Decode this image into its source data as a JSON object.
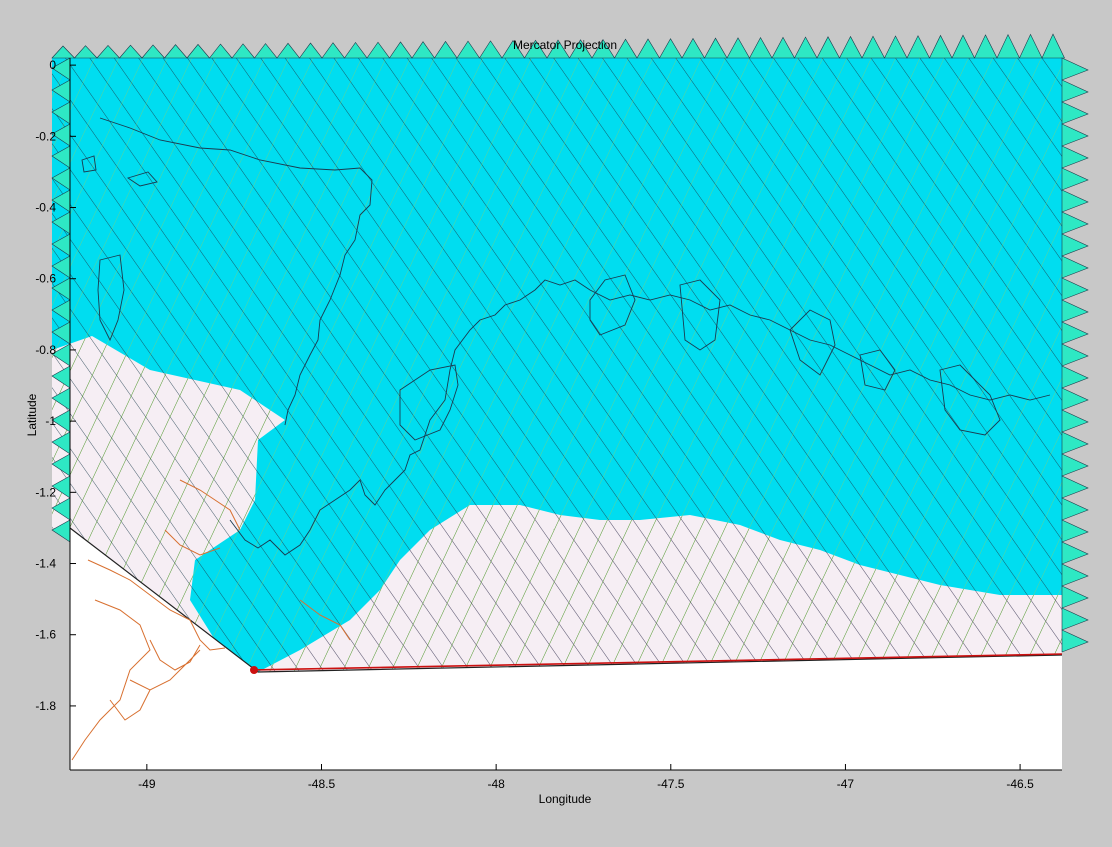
{
  "figure": {
    "title": "Mercator Projection",
    "xlabel": "Longitude",
    "ylabel": "Latitude"
  },
  "map_data": {
    "xticks": [
      -49,
      -48.5,
      -48,
      -47.5,
      -47,
      -46.5
    ],
    "yticks": [
      0,
      -0.2,
      -0.4,
      -0.6,
      -0.8,
      -1,
      -1.2,
      -1.4,
      -1.6,
      -1.8
    ],
    "xtick_labels": [
      "-49",
      "-48.5",
      "-48",
      "-47.5",
      "-47",
      "-46.5"
    ],
    "ytick_labels": [
      "0",
      "-0.2",
      "-0.4",
      "-0.6",
      "-0.8",
      "-1",
      "-1.2",
      "-1.4",
      "-1.6",
      "-1.8"
    ],
    "xlim": [
      -49.22,
      -46.38
    ],
    "ylim": [
      -1.98,
      0.02
    ],
    "grid_color": "#00ddf0",
    "grid_edge_color": "#2ee8c4",
    "land_color": "#f8f0f4",
    "coast_color": "#1a3a50",
    "contour_color": "#d87030",
    "boundary_color": "#cc1010"
  }
}
